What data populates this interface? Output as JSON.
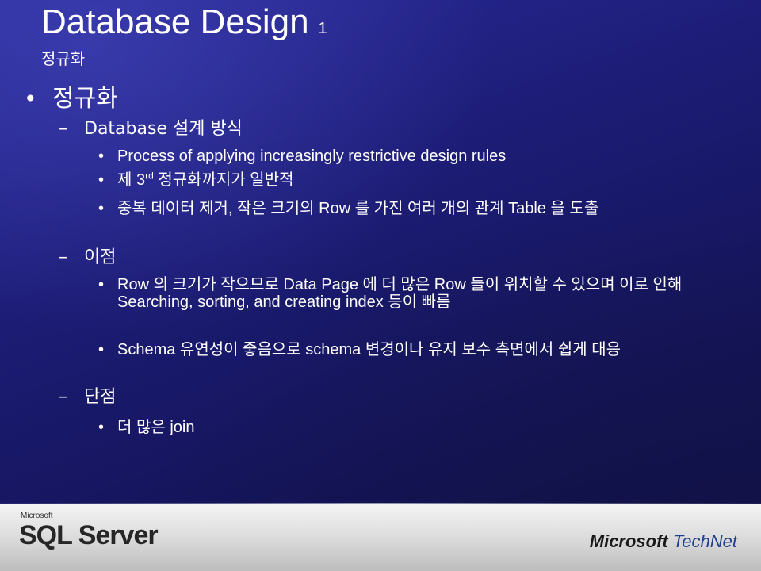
{
  "slide": {
    "title": "Database Design",
    "title_number": "1",
    "subtitle": "정규화",
    "bullet_l1": "•",
    "bullet_l2": "–",
    "bullet_l3": "•",
    "main_point": "정규화",
    "sections": [
      {
        "heading": "Database 설계 방식",
        "items": [
          "Process of applying increasingly restrictive design rules",
          {
            "prefix": "제 3",
            "sup": "rd",
            "suffix": " 정규화까지가 일반적"
          },
          "중복 데이터 제거, 작은 크기의 Row 를 가진 여러 개의 관계 Table 을 도출"
        ]
      },
      {
        "heading": "이점",
        "items": [
          "Row 의 크기가 작으므로 Data Page 에 더 많은 Row 들이 위치할 수 있으며 이로 인해 Searching, sorting, and creating index 등이 빠름",
          "Schema 유연성이 좋음으로 schema 변경이나 유지 보수 측면에서 쉽게 대응"
        ]
      },
      {
        "heading": "단점",
        "items": [
          "더 많은 join"
        ]
      }
    ]
  },
  "footer": {
    "left_brand_small": "Microsoft",
    "left_brand_product": "SQL Server",
    "right_brand_ms": "Microsoft",
    "right_brand_tn": "TechNet"
  }
}
